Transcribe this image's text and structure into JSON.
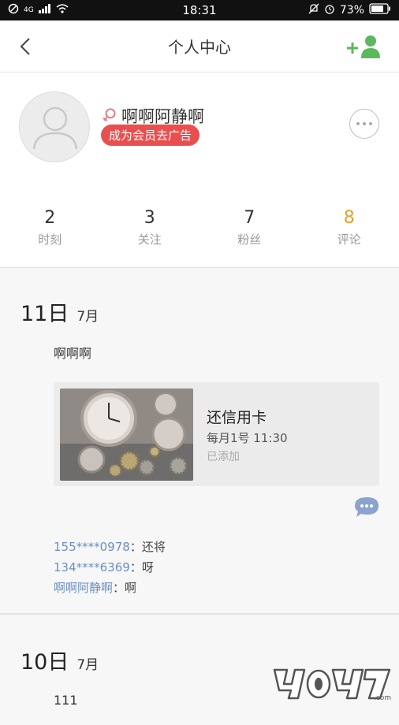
{
  "statusbar": {
    "time": "18:31",
    "battery": "73%",
    "network": "4G"
  },
  "header": {
    "title": "个人中心"
  },
  "profile": {
    "name": "啊啊阿静啊",
    "vip_label": "成为会员去广告",
    "stats": [
      {
        "num": "2",
        "label": "时刻"
      },
      {
        "num": "3",
        "label": "关注"
      },
      {
        "num": "7",
        "label": "粉丝"
      },
      {
        "num": "8",
        "label": "评论"
      }
    ]
  },
  "days": [
    {
      "day": "11日",
      "month": "7月",
      "text": "啊啊啊",
      "card": {
        "title": "还信用卡",
        "time": "每月1号 11:30",
        "status": "已添加"
      },
      "comments": [
        {
          "user": "155****0978",
          "text": "还将"
        },
        {
          "user": "134****6369",
          "text": "呀"
        },
        {
          "user": "啊啊阿静啊",
          "text": "啊"
        }
      ]
    },
    {
      "day": "10日",
      "month": "7月",
      "text": "111"
    }
  ],
  "colors": {
    "accent_green": "#5cb85c",
    "vip_red": "#e94f4f",
    "active_stat": "#e8a02c",
    "link_blue": "#6a8fc3"
  }
}
